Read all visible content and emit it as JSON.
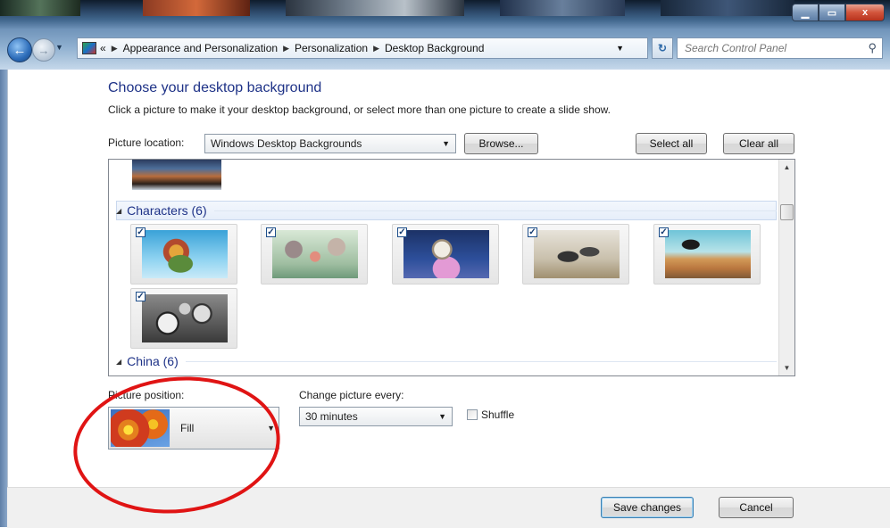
{
  "window": {
    "controls": {
      "minimize_icon": "minimize-icon",
      "maximize_icon": "maximize-icon",
      "close_label": "x"
    }
  },
  "nav": {
    "breadcrumb_prefix": "«",
    "breadcrumbs": [
      "Appearance and Personalization",
      "Personalization",
      "Desktop Background"
    ],
    "search_placeholder": "Search Control Panel"
  },
  "page": {
    "title": "Choose your desktop background",
    "subtitle": "Click a picture to make it your desktop background, or select more than one picture to create a slide show.",
    "picture_location_label": "Picture location:",
    "picture_location_value": "Windows Desktop Backgrounds",
    "browse_label": "Browse...",
    "select_all_label": "Select all",
    "clear_all_label": "Clear all"
  },
  "gallery": {
    "groups": [
      {
        "name": "Characters (6)",
        "checked_count": 6
      },
      {
        "name": "China (6)"
      }
    ],
    "check_mark": "✓"
  },
  "options": {
    "picture_position_label": "Picture position:",
    "picture_position_value": "Fill",
    "change_every_label": "Change picture every:",
    "change_every_value": "30 minutes",
    "shuffle_label": "Shuffle",
    "shuffle_checked": false
  },
  "footer": {
    "save_label": "Save changes",
    "cancel_label": "Cancel"
  },
  "colors": {
    "heading": "#1e3287",
    "annotation": "#e01414"
  }
}
